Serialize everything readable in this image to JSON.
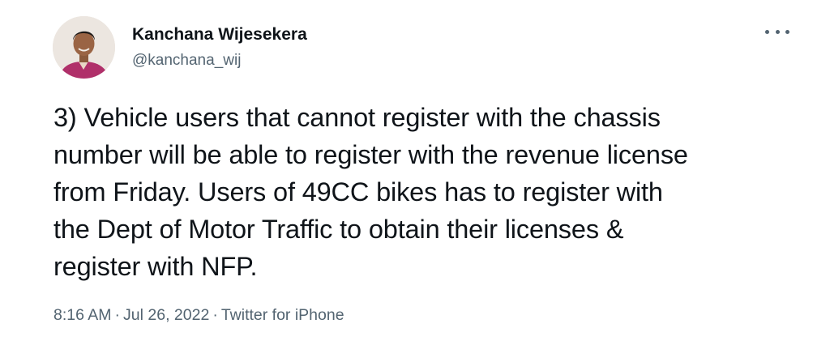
{
  "author": {
    "display_name": "Kanchana Wijesekera",
    "handle": "@kanchana_wij",
    "avatar_icon": "profile-photo"
  },
  "tweet": {
    "text_lines": [
      "3) Vehicle users that cannot register with the chassis",
      "number will be able to register with the revenue license",
      "from Friday. Users of 49CC bikes has to register with",
      "the Dept of Motor Traffic to obtain their licenses &",
      "register with NFP."
    ],
    "time": "8:16 AM",
    "date": "Jul 26, 2022",
    "source": "Twitter for iPhone",
    "separator": "·"
  },
  "more_icon": "more-horizontal-icon",
  "colors": {
    "text_primary": "#0f1419",
    "text_secondary": "#536471",
    "background": "#ffffff"
  }
}
